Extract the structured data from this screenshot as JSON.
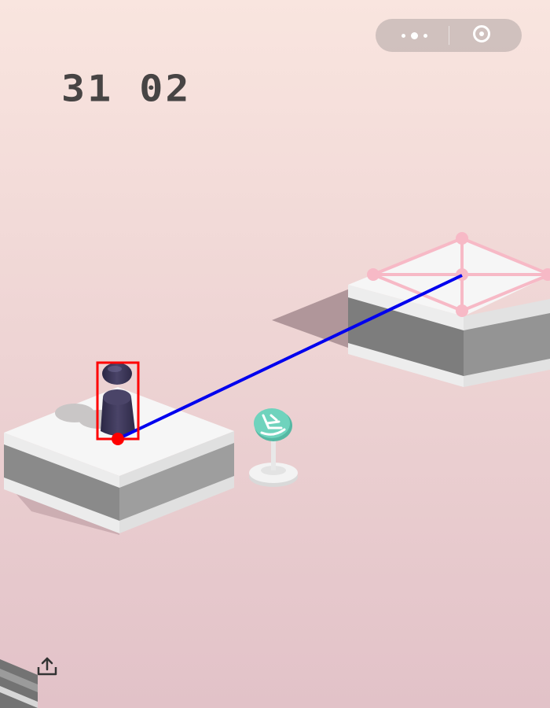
{
  "game": {
    "score": "31 02"
  },
  "colors": {
    "background_top": "#f9e5df",
    "background_bottom": "#e2c2c8",
    "platform_top": "#f5f5f5",
    "platform_dark": "#8d8d8d",
    "player": "#3a3556",
    "sign": "#6fd3bd",
    "target_marker": "#f7b9c6",
    "aim_line": "#0000ee",
    "annotation": "#ff0000"
  },
  "icons": {
    "menu": "more-dots-icon",
    "record": "record-target-icon",
    "sign": "rocking-chair-icon",
    "share": "share-upload-icon"
  }
}
